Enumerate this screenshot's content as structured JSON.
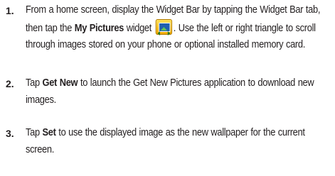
{
  "steps": [
    {
      "number": "1.",
      "parts": {
        "a": "From a home screen, display the Widget Bar by tapping the Widget Bar tab, then tap the ",
        "b": "My Pictures",
        "c": " widget ",
        "d": ". Use the left or right triangle to scroll through images stored on your phone or optional installed memory card."
      },
      "icon": "my-pictures-widget-icon"
    },
    {
      "number": "2.",
      "parts": {
        "a": "Tap ",
        "b": "Get New",
        "c": " to launch the Get New Pictures application to download new images."
      }
    },
    {
      "number": "3.",
      "parts": {
        "a": "Tap ",
        "b": "Set",
        "c": " to use the displayed image as the new wallpaper for the current screen."
      }
    }
  ]
}
